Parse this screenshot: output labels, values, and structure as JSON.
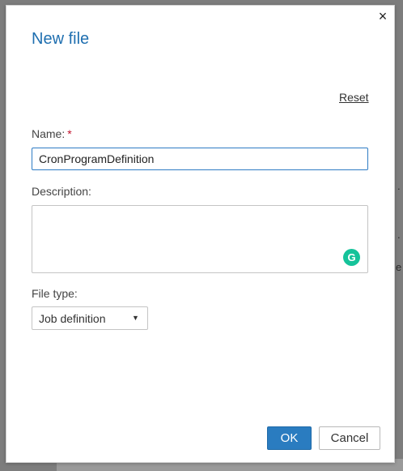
{
  "dialog": {
    "title": "New file",
    "close_glyph": "×",
    "reset_label": "Reset",
    "name": {
      "label": "Name:",
      "required_marker": "*",
      "value": "CronProgramDefinition"
    },
    "description": {
      "label": "Description:",
      "value": ""
    },
    "file_type": {
      "label": "File type:",
      "selected": "Job definition",
      "caret_glyph": "▼"
    },
    "assistant_badge": {
      "icon": "grammarly-icon",
      "glyph": "G"
    },
    "ok_label": "OK",
    "cancel_label": "Cancel"
  },
  "colors": {
    "accent": "#1f6fb0",
    "primary_button": "#2a7cc0",
    "required": "#c0102b",
    "grammarly": "#15c39a"
  }
}
